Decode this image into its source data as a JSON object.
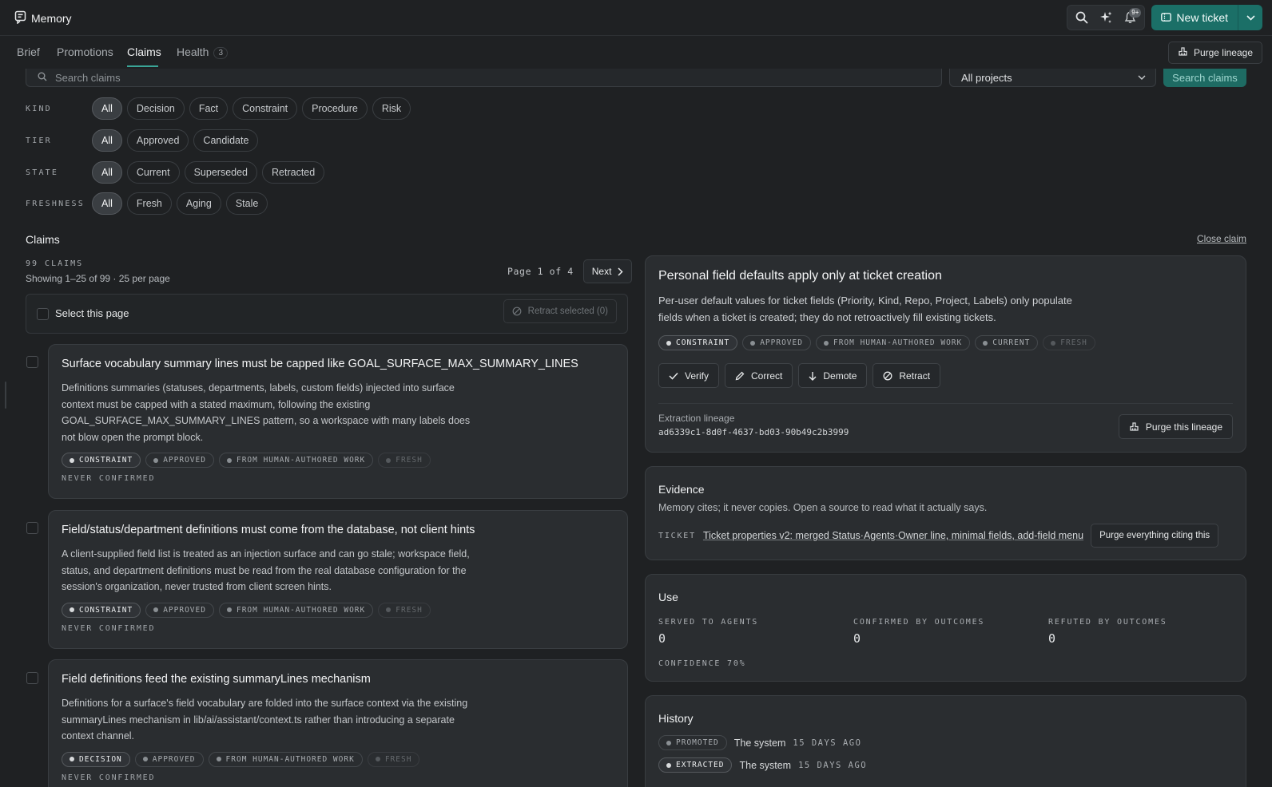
{
  "app": {
    "title": "Memory",
    "notification_count": "9+",
    "new_ticket_label": "New ticket"
  },
  "tabs": [
    {
      "label": "Brief"
    },
    {
      "label": "Promotions"
    },
    {
      "label": "Claims"
    },
    {
      "label": "Health",
      "count": "3"
    }
  ],
  "purge_lineage_label": "Purge lineage",
  "search": {
    "placeholder": "Search claims",
    "project_value": "All projects",
    "button_label": "Search claims"
  },
  "filters": {
    "kind": {
      "label": "KIND",
      "options": [
        "All",
        "Decision",
        "Fact",
        "Constraint",
        "Procedure",
        "Risk"
      ]
    },
    "tier": {
      "label": "TIER",
      "options": [
        "All",
        "Approved",
        "Candidate"
      ]
    },
    "state": {
      "label": "STATE",
      "options": [
        "All",
        "Current",
        "Superseded",
        "Retracted"
      ]
    },
    "freshness": {
      "label": "FRESHNESS",
      "options": [
        "All",
        "Fresh",
        "Aging",
        "Stale"
      ]
    }
  },
  "claims_section": {
    "title": "Claims",
    "close_label": "Close claim",
    "count_label": "99 CLAIMS",
    "showing": "Showing 1–25 of 99 · 25 per page",
    "page_label": "Page 1 of 4",
    "next_label": "Next",
    "select_page_label": "Select this page",
    "retract_selected_label": "Retract selected (0)"
  },
  "claims": [
    {
      "title": "Surface vocabulary summary lines must be capped like GOAL_SURFACE_MAX_SUMMARY_LINES",
      "body": "Definitions summaries (statuses, departments, labels, custom fields) injected into surface context must be capped with a stated maximum, following the existing GOAL_SURFACE_MAX_SUMMARY_LINES pattern, so a workspace with many labels does not blow open the prompt block.",
      "badges": [
        "CONSTRAINT",
        "APPROVED",
        "FROM HUMAN-AUTHORED WORK",
        "FRESH"
      ],
      "confirmation": "NEVER CONFIRMED"
    },
    {
      "title": "Field/status/department definitions must come from the database, not client hints",
      "body": "A client-supplied field list is treated as an injection surface and can go stale; workspace field, status, and department definitions must be read from the real database configuration for the session's organization, never trusted from client screen hints.",
      "badges": [
        "CONSTRAINT",
        "APPROVED",
        "FROM HUMAN-AUTHORED WORK",
        "FRESH"
      ],
      "confirmation": "NEVER CONFIRMED"
    },
    {
      "title": "Field definitions feed the existing summaryLines mechanism",
      "body": "Definitions for a surface's field vocabulary are folded into the surface context via the existing summaryLines mechanism in lib/ai/assistant/context.ts rather than introducing a separate context channel.",
      "badges": [
        "DECISION",
        "APPROVED",
        "FROM HUMAN-AUTHORED WORK",
        "FRESH"
      ],
      "confirmation": "NEVER CONFIRMED"
    }
  ],
  "detail": {
    "title": "Personal field defaults apply only at ticket creation",
    "body": "Per-user default values for ticket fields (Priority, Kind, Repo, Project, Labels) only populate fields when a ticket is created; they do not retroactively fill existing tickets.",
    "badges": [
      "CONSTRAINT",
      "APPROVED",
      "FROM HUMAN-AUTHORED WORK",
      "CURRENT",
      "FRESH"
    ],
    "actions": [
      "Verify",
      "Correct",
      "Demote",
      "Retract"
    ],
    "lineage_label": "Extraction lineage",
    "lineage_id": "ad6339c1-8d0f-4637-bd03-90b49c2b3999",
    "purge_this_label": "Purge this lineage"
  },
  "evidence": {
    "title": "Evidence",
    "subtitle": "Memory cites; it never copies. Open a source to read what it actually says.",
    "kind": "TICKET",
    "link": "Ticket properties v2: merged Status·Agents·Owner line, minimal fields, add-field menu",
    "purge_label": "Purge everything citing this"
  },
  "use": {
    "title": "Use",
    "stats": [
      {
        "label": "SERVED TO AGENTS",
        "value": "0"
      },
      {
        "label": "CONFIRMED BY OUTCOMES",
        "value": "0"
      },
      {
        "label": "REFUTED BY OUTCOMES",
        "value": "0"
      }
    ],
    "confidence": "CONFIDENCE 70%"
  },
  "history": {
    "title": "History",
    "events": [
      {
        "badge": "PROMOTED",
        "actor": "The system",
        "when": "15 DAYS AGO"
      },
      {
        "badge": "EXTRACTED",
        "actor": "The system",
        "when": "15 DAYS AGO"
      }
    ]
  }
}
